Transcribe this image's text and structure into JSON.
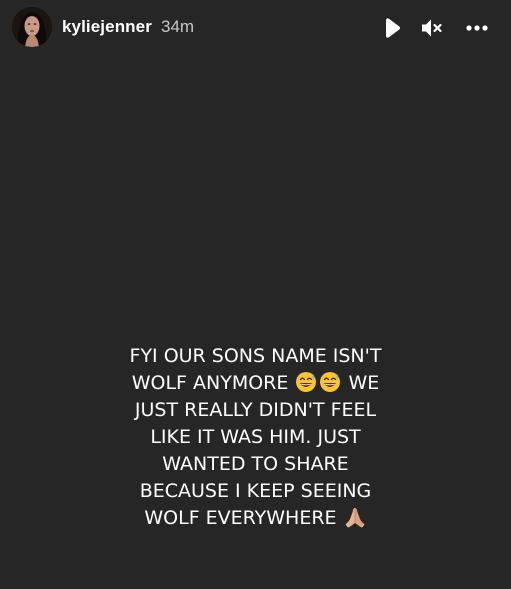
{
  "header": {
    "username": "kyliejenner",
    "time_ago": "34m",
    "icons": {
      "avatar": "profile-avatar",
      "play": "play-icon",
      "mute": "speaker-muted-icon",
      "more": "more-options-icon"
    }
  },
  "story": {
    "background_color": "#262626",
    "text_lines": [
      "FYI OUR SONS NAME ISN'T",
      "WOLF ANYMORE",
      "WE",
      "JUST REALLY DIDN'T FEEL",
      "LIKE IT WAS HIM. JUST",
      "WANTED TO SHARE",
      "BECAUSE I KEEP SEEING",
      "WOLF EVERYWHERE"
    ],
    "emojis": {
      "line2": [
        "grinning-sweat-emoji",
        "grinning-sweat-emoji"
      ],
      "line7": [
        "folded-hands-emoji"
      ]
    }
  }
}
